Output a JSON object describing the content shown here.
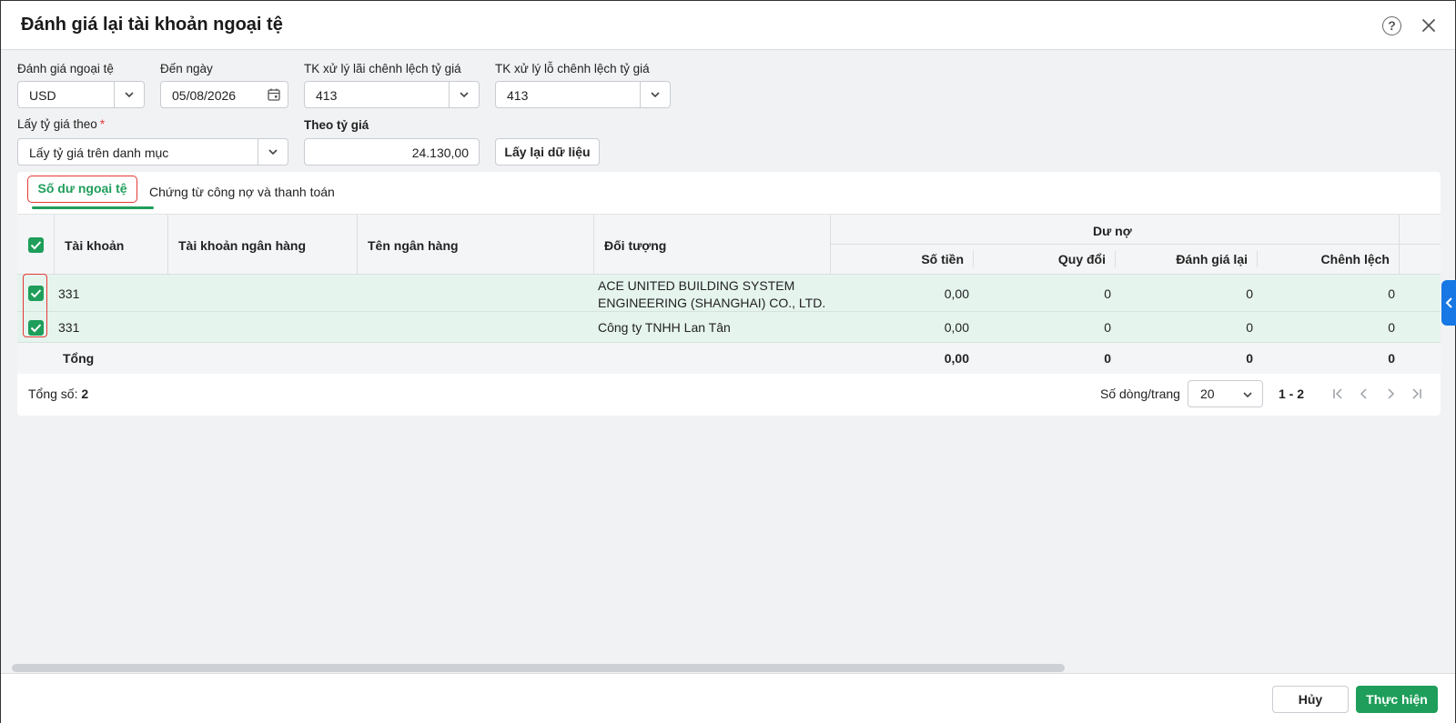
{
  "dialog": {
    "title": "Đánh giá lại tài khoản ngoại tệ"
  },
  "form": {
    "currency_label": "Đánh giá ngoại tệ",
    "currency_value": "USD",
    "date_label": "Đến ngày",
    "date_value": "05/08/2026",
    "gain_account_label": "TK xử lý lãi chênh lệch tỷ giá",
    "gain_account_value": "413",
    "loss_account_label": "TK xử lý lỗ chênh lệch tỷ giá",
    "loss_account_value": "413",
    "rate_source_label": "Lấy tỷ giá theo",
    "rate_source_required": "*",
    "rate_source_value": "Lấy tỷ giá trên danh mục",
    "rate_label": "Theo tỷ giá",
    "rate_value": "24.130,00",
    "reload_button": "Lấy lại dữ liệu"
  },
  "tabs": [
    {
      "label": "Số dư ngoại tệ",
      "active": true
    },
    {
      "label": "Chứng từ công nợ và thanh toán",
      "active": false
    }
  ],
  "table": {
    "headers": {
      "account": "Tài khoản",
      "bank_account": "Tài khoản ngân hàng",
      "bank_name": "Tên ngân hàng",
      "object": "Đối tượng",
      "debit_group": "Dư nợ",
      "amount": "Số tiền",
      "converted": "Quy đổi",
      "revalued": "Đánh giá lại",
      "difference": "Chênh lệch"
    },
    "rows": [
      {
        "checked": true,
        "account": "331",
        "bank_account": "",
        "bank_name": "",
        "object_line1": "ACE UNITED BUILDING SYSTEM",
        "object_line2": "ENGINEERING (SHANGHAI) CO., LTD.",
        "amount": "0,00",
        "converted": "0",
        "revalued": "0",
        "difference": "0"
      },
      {
        "checked": true,
        "account": "331",
        "bank_account": "",
        "bank_name": "",
        "object_line1": "Công ty TNHH Lan Tân",
        "object_line2": "",
        "amount": "0,00",
        "converted": "0",
        "revalued": "0",
        "difference": "0"
      }
    ],
    "total": {
      "label": "Tổng",
      "amount": "0,00",
      "converted": "0",
      "revalued": "0",
      "difference": "0"
    }
  },
  "footer": {
    "total_label": "Tổng số:",
    "total_count": "2",
    "rows_per_page_label": "Số dòng/trang",
    "rows_per_page_value": "20",
    "range": "1 - 2"
  },
  "actions": {
    "cancel": "Hủy",
    "submit": "Thực hiện"
  },
  "colors": {
    "accent": "#1e9e5a",
    "highlight_border": "#e53935",
    "row_selected_bg": "#e6f4ee",
    "side_tab": "#1677e5"
  }
}
